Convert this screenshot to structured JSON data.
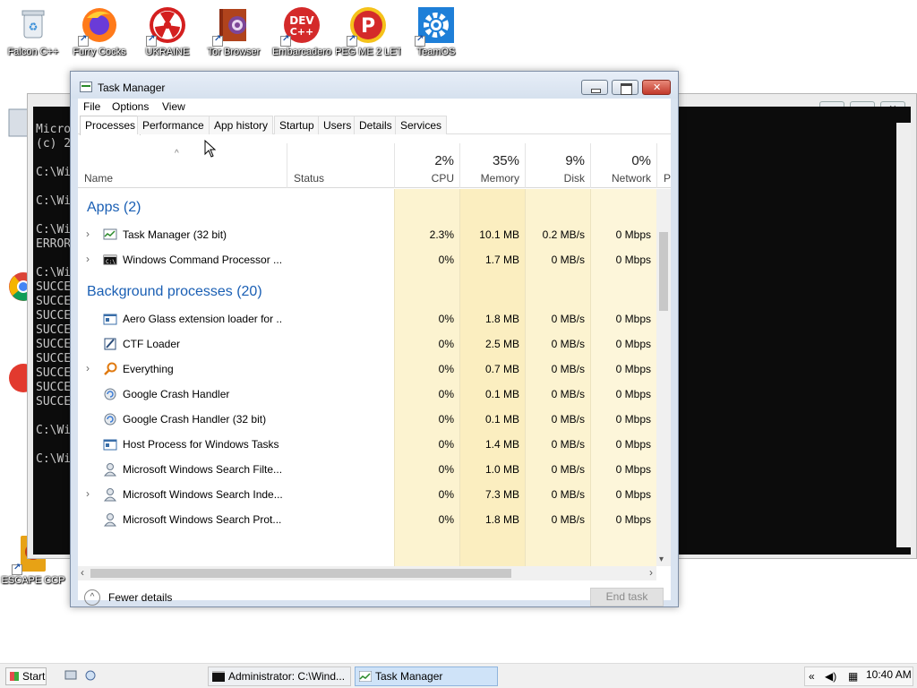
{
  "desktop": {
    "icons": [
      {
        "label": "Falcon C++",
        "icon": "recycle-bin-icon"
      },
      {
        "label": "Furry Cocks",
        "icon": "firefox-icon"
      },
      {
        "label": "UKRAINE",
        "icon": "radiation-icon"
      },
      {
        "label": "Tor Browser",
        "icon": "tor-browser-icon"
      },
      {
        "label": "Embarcadero",
        "icon": "devcpp-icon"
      },
      {
        "label": "PEG ME 2 LET",
        "icon": "peg-icon"
      },
      {
        "label": "TeamOS",
        "icon": "gear-icon"
      }
    ],
    "left_icons": [
      {
        "label": "ESCAPE CCP",
        "icon": "escape-icon"
      }
    ]
  },
  "console": {
    "title": "Administrator: C:\\Wind...",
    "lines": [
      "Micro",
      "(c) 2",
      "C:\\Wi",
      "C:\\Wi",
      "C:\\Wi",
      "ERROR",
      "C:\\Wi",
      "SUCCE",
      "SUCCE",
      "SUCCE",
      "SUCCE",
      "SUCCE",
      "SUCCE",
      "SUCCE",
      "SUCCE",
      "SUCCE",
      "C:\\Wi",
      "C:\\Wi"
    ]
  },
  "task_manager": {
    "title": "Task Manager",
    "menu": [
      "File",
      "Options",
      "View"
    ],
    "tabs": [
      "Processes",
      "Performance",
      "App history",
      "Startup",
      "Users",
      "Details",
      "Services"
    ],
    "columns": {
      "name": "Name",
      "status": "Status",
      "cpu": {
        "pct": "2%",
        "label": "CPU"
      },
      "memory": {
        "pct": "35%",
        "label": "Memory"
      },
      "disk": {
        "pct": "9%",
        "label": "Disk"
      },
      "network": {
        "pct": "0%",
        "label": "Network"
      },
      "power": "P"
    },
    "groups": {
      "apps": "Apps (2)",
      "background": "Background processes (20)"
    },
    "apps": [
      {
        "name": "Task Manager (32 bit)",
        "cpu": "2.3%",
        "memory": "10.1 MB",
        "disk": "0.2 MB/s",
        "network": "0 Mbps",
        "icon": "task-manager-icon"
      },
      {
        "name": "Windows Command Processor ...",
        "cpu": "0%",
        "memory": "1.7 MB",
        "disk": "0 MB/s",
        "network": "0 Mbps",
        "icon": "cmd-icon"
      }
    ],
    "background": [
      {
        "name": "Aero Glass extension loader for ...",
        "cpu": "0%",
        "memory": "1.8 MB",
        "disk": "0 MB/s",
        "network": "0 Mbps",
        "icon": "window-icon"
      },
      {
        "name": "CTF Loader",
        "cpu": "0%",
        "memory": "2.5 MB",
        "disk": "0 MB/s",
        "network": "0 Mbps",
        "icon": "ctf-loader-icon"
      },
      {
        "name": "Everything",
        "cpu": "0%",
        "memory": "0.7 MB",
        "disk": "0 MB/s",
        "network": "0 Mbps",
        "icon": "magnifier-icon"
      },
      {
        "name": "Google Crash Handler",
        "cpu": "0%",
        "memory": "0.1 MB",
        "disk": "0 MB/s",
        "network": "0 Mbps",
        "icon": "google-update-icon"
      },
      {
        "name": "Google Crash Handler (32 bit)",
        "cpu": "0%",
        "memory": "0.1 MB",
        "disk": "0 MB/s",
        "network": "0 Mbps",
        "icon": "google-update-icon"
      },
      {
        "name": "Host Process for Windows Tasks",
        "cpu": "0%",
        "memory": "1.4 MB",
        "disk": "0 MB/s",
        "network": "0 Mbps",
        "icon": "window-icon"
      },
      {
        "name": "Microsoft Windows Search Filte...",
        "cpu": "0%",
        "memory": "1.0 MB",
        "disk": "0 MB/s",
        "network": "0 Mbps",
        "icon": "search-user-icon"
      },
      {
        "name": "Microsoft Windows Search Inde...",
        "cpu": "0%",
        "memory": "7.3 MB",
        "disk": "0 MB/s",
        "network": "0 Mbps",
        "icon": "search-user-icon"
      },
      {
        "name": "Microsoft Windows Search Prot...",
        "cpu": "0%",
        "memory": "1.8 MB",
        "disk": "0 MB/s",
        "network": "0 Mbps",
        "icon": "search-user-icon"
      }
    ],
    "fewer_details": "Fewer details",
    "end_task": "End task"
  },
  "taskbar": {
    "start": "Start",
    "buttons": [
      {
        "label": "Administrator: C:\\Wind...",
        "icon": "cmd-icon"
      },
      {
        "label": "Task Manager",
        "icon": "task-manager-icon"
      }
    ],
    "clock": "10:40 AM"
  },
  "colors": {
    "accent": "#1a5fb4",
    "usage_light": "#fdf5d5",
    "usage_mid": "#fbefc2",
    "usage_strong": "#f9e3a0"
  }
}
